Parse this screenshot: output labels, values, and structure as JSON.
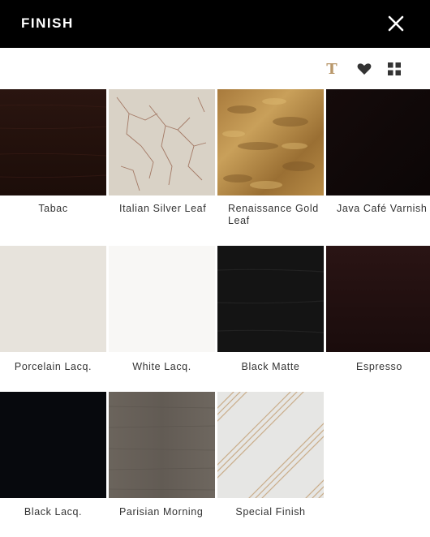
{
  "header": {
    "title": "FINISH"
  },
  "toolbar": {
    "text_icon": "text-icon",
    "favorite_icon": "heart-icon",
    "grid_icon": "grid-icon",
    "text_glyph": "T",
    "accent_color": "#b8976a"
  },
  "finishes": [
    {
      "name": "Tabac"
    },
    {
      "name": "Italian Silver Leaf"
    },
    {
      "name": "Renaissance Gold Leaf"
    },
    {
      "name": "Java Café Varnish"
    },
    {
      "name": "Porcelain Lacq."
    },
    {
      "name": "White Lacq."
    },
    {
      "name": "Black Matte"
    },
    {
      "name": "Espresso"
    },
    {
      "name": "Black Lacq."
    },
    {
      "name": "Parisian Morning"
    },
    {
      "name": "Special Finish"
    }
  ]
}
